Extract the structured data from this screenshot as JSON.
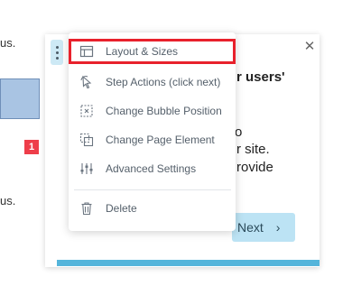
{
  "page": {
    "fragment_top": "us.",
    "fragment_bottom": "us.",
    "badge": "1"
  },
  "bubble": {
    "title": "r users'",
    "line1": "o",
    "line2": "r site.",
    "line3": "rovide",
    "next_label": "Next",
    "close_icon": "close-icon"
  },
  "menu": {
    "items": [
      {
        "label": "Layout & Sizes",
        "icon": "layout-icon"
      },
      {
        "label": "Step Actions (click next)",
        "icon": "pointer-icon"
      },
      {
        "label": "Change Bubble Position",
        "icon": "bubble-position-icon"
      },
      {
        "label": "Change Page Element",
        "icon": "page-element-icon"
      },
      {
        "label": "Advanced Settings",
        "icon": "sliders-icon"
      },
      {
        "label": "Delete",
        "icon": "trash-icon"
      }
    ]
  },
  "colors": {
    "highlight": "#e8212c",
    "accent": "#55b5db",
    "next_bg": "#bce3f4"
  }
}
